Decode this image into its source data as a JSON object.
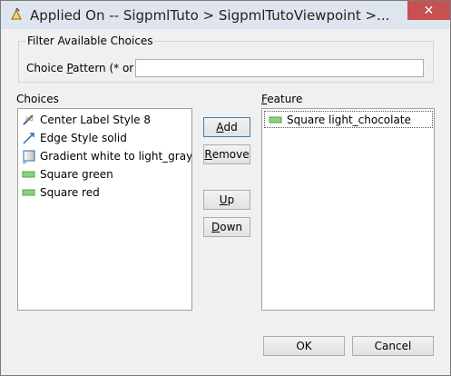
{
  "window": {
    "title": "Applied On -- SigpmlTuto > SigpmlTutoViewpoint >...",
    "close_glyph": "✕"
  },
  "filter": {
    "legend": "Filter Available Choices",
    "pattern_label_prefix": "Choice ",
    "pattern_label_mnemonic": "P",
    "pattern_label_suffix": "attern (* or ?)",
    "pattern_value": ""
  },
  "choices": {
    "label": "Choices",
    "items": [
      {
        "label": "Center Label Style 8",
        "icon": "label-style-icon"
      },
      {
        "label": "Edge Style solid",
        "icon": "edge-style-icon"
      },
      {
        "label": "Gradient white to light_gray",
        "icon": "gradient-icon"
      },
      {
        "label": "Square green",
        "icon": "square-icon"
      },
      {
        "label": "Square red",
        "icon": "square-icon"
      }
    ]
  },
  "feature": {
    "label_mnemonic": "F",
    "label_suffix": "eature",
    "items": [
      {
        "label": "Square light_chocolate",
        "icon": "square-icon"
      }
    ]
  },
  "buttons": {
    "add_mnemonic": "A",
    "add_rest": "dd",
    "remove_mnemonic": "R",
    "remove_rest": "emove",
    "up_mnemonic": "U",
    "up_rest": "p",
    "down_mnemonic": "D",
    "down_rest": "own",
    "ok": "OK",
    "cancel": "Cancel"
  },
  "colors": {
    "square_icon_fill": "#8bd37a",
    "square_icon_border": "#5aa04a"
  }
}
